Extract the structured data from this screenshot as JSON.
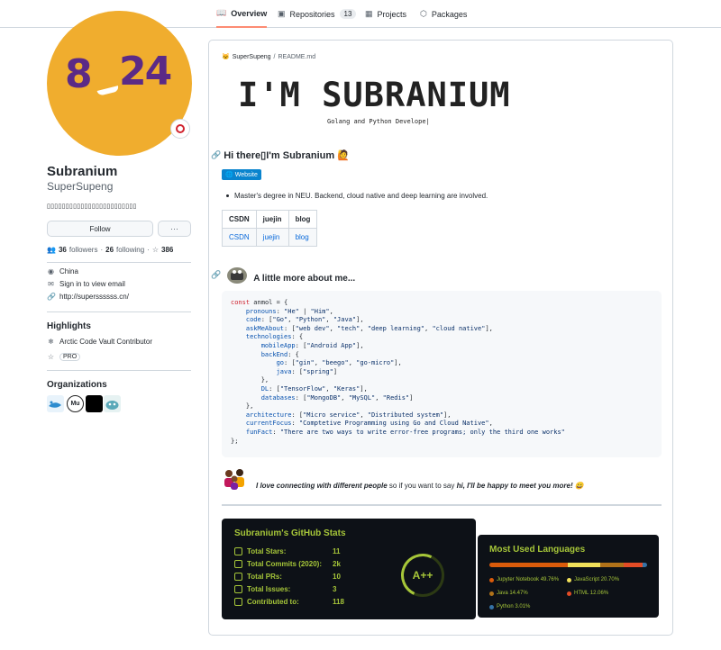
{
  "nav": {
    "tabs": [
      {
        "label": "Overview",
        "icon": "book-icon"
      },
      {
        "label": "Repositories",
        "icon": "repo-icon",
        "count": "13"
      },
      {
        "label": "Projects",
        "icon": "table-icon"
      },
      {
        "label": "Packages",
        "icon": "package-icon"
      }
    ]
  },
  "profile": {
    "avatar_text_left": "8",
    "avatar_text_right": "24",
    "name": "Subranium",
    "login": "SuperSupeng",
    "bio": "▯▯▯▯▯▯▯▯▯▯▯▯▯▯▯▯▯▯▯▯▯▯▯▯",
    "follow_label": "Follow",
    "more_label": "···",
    "followers_count": "36",
    "followers_label": "followers",
    "dot": "·",
    "following_count": "26",
    "following_label": "following",
    "stars_count": "386",
    "location": "China",
    "email": "Sign in to view email",
    "website": "http://superssssss.cn/"
  },
  "highlights": {
    "title": "Highlights",
    "items": [
      "Arctic Code Vault Contributor",
      "PRO"
    ]
  },
  "organizations": {
    "title": "Organizations",
    "org2_text": "Mu"
  },
  "readme": {
    "owner": "SuperSupeng",
    "slash": "/",
    "file": "README.md",
    "banner_title": "I'M SUBRANIUM",
    "banner_subtitle": "Golang and Python Develope|",
    "greeting": "Hi there▯I'm Subranium 🙋",
    "website_badge": "Website",
    "bullet": "Master's degree in NEU. Backend, cloud native and deep learning are involved.",
    "table": {
      "headers": [
        "CSDN",
        "juejin",
        "blog"
      ],
      "row": [
        "CSDN",
        "juejin",
        "blog"
      ]
    },
    "little_more": "A little more about me...",
    "connect_bold": "I love connecting with different people",
    "connect_middle": "so if you want to say",
    "connect_end": "hi, I'll be happy to meet you more! 😀"
  },
  "code_lines": [
    [
      [
        "k",
        "const "
      ],
      [
        "t",
        "anmol = {"
      ]
    ],
    [
      [
        "t",
        "    "
      ],
      [
        "p",
        "pronouns"
      ],
      [
        "t",
        ": "
      ],
      [
        "s",
        "\"He\""
      ],
      [
        "t",
        " | "
      ],
      [
        "s",
        "\"Him\""
      ],
      [
        "t",
        ","
      ]
    ],
    [
      [
        "t",
        "    "
      ],
      [
        "p",
        "code"
      ],
      [
        "t",
        ": ["
      ],
      [
        "s",
        "\"Go\""
      ],
      [
        "t",
        ", "
      ],
      [
        "s",
        "\"Python\""
      ],
      [
        "t",
        ", "
      ],
      [
        "s",
        "\"Java\""
      ],
      [
        "t",
        "],"
      ]
    ],
    [
      [
        "t",
        "    "
      ],
      [
        "p",
        "askMeAbout"
      ],
      [
        "t",
        ": ["
      ],
      [
        "s",
        "\"web dev\""
      ],
      [
        "t",
        ", "
      ],
      [
        "s",
        "\"tech\""
      ],
      [
        "t",
        ", "
      ],
      [
        "s",
        "\"deep learning\""
      ],
      [
        "t",
        ", "
      ],
      [
        "s",
        "\"cloud native\""
      ],
      [
        "t",
        "],"
      ]
    ],
    [
      [
        "t",
        "    "
      ],
      [
        "p",
        "technologies"
      ],
      [
        "t",
        ": {"
      ]
    ],
    [
      [
        "t",
        "        "
      ],
      [
        "p",
        "mobileApp"
      ],
      [
        "t",
        ": ["
      ],
      [
        "s",
        "\"Android App\""
      ],
      [
        "t",
        "],"
      ]
    ],
    [
      [
        "t",
        "        "
      ],
      [
        "p",
        "backEnd"
      ],
      [
        "t",
        ": {"
      ]
    ],
    [
      [
        "t",
        "            "
      ],
      [
        "p",
        "go"
      ],
      [
        "t",
        ": ["
      ],
      [
        "s",
        "\"gin\""
      ],
      [
        "t",
        ", "
      ],
      [
        "s",
        "\"beego\""
      ],
      [
        "t",
        ", "
      ],
      [
        "s",
        "\"go-micro\""
      ],
      [
        "t",
        "],"
      ]
    ],
    [
      [
        "t",
        "            "
      ],
      [
        "p",
        "java"
      ],
      [
        "t",
        ": ["
      ],
      [
        "s",
        "\"spring\""
      ],
      [
        "t",
        "]"
      ]
    ],
    [
      [
        "t",
        "        },"
      ]
    ],
    [
      [
        "t",
        "        "
      ],
      [
        "p",
        "DL"
      ],
      [
        "t",
        ": ["
      ],
      [
        "s",
        "\"TensorFlow\""
      ],
      [
        "t",
        ", "
      ],
      [
        "s",
        "\"Keras\""
      ],
      [
        "t",
        "],"
      ]
    ],
    [
      [
        "t",
        "        "
      ],
      [
        "p",
        "databases"
      ],
      [
        "t",
        ": ["
      ],
      [
        "s",
        "\"MongoDB\""
      ],
      [
        "t",
        ", "
      ],
      [
        "s",
        "\"MySQL\""
      ],
      [
        "t",
        ", "
      ],
      [
        "s",
        "\"Redis\""
      ],
      [
        "t",
        "]"
      ]
    ],
    [
      [
        "t",
        "    },"
      ]
    ],
    [
      [
        "t",
        "    "
      ],
      [
        "p",
        "architecture"
      ],
      [
        "t",
        ": ["
      ],
      [
        "s",
        "\"Micro service\""
      ],
      [
        "t",
        ", "
      ],
      [
        "s",
        "\"Distributed system\""
      ],
      [
        "t",
        "],"
      ]
    ],
    [
      [
        "t",
        "    "
      ],
      [
        "p",
        "currentFocus"
      ],
      [
        "t",
        ": "
      ],
      [
        "s",
        "\"Comptetive Programming using Go and Cloud Native\""
      ],
      [
        "t",
        ","
      ]
    ],
    [
      [
        "t",
        "    "
      ],
      [
        "p",
        "funFact"
      ],
      [
        "t",
        ": "
      ],
      [
        "s",
        "\"There are two ways to write error-free programs; only the third one works\""
      ]
    ],
    [
      [
        "t",
        "};"
      ]
    ]
  ],
  "stats": {
    "title": "Subranium's GitHub Stats",
    "rows": [
      {
        "label": "Total Stars:",
        "value": "11"
      },
      {
        "label": "Total Commits (2020):",
        "value": "2k"
      },
      {
        "label": "Total PRs:",
        "value": "10"
      },
      {
        "label": "Total Issues:",
        "value": "3"
      },
      {
        "label": "Contributed to:",
        "value": "118"
      }
    ],
    "grade": "A++"
  },
  "languages": {
    "title": "Most Used Languages",
    "items": [
      {
        "name": "Jupyter Notebook 49.76%",
        "color": "#DA5B0B",
        "pct": 49.76
      },
      {
        "name": "JavaScript 20.70%",
        "color": "#f1e05a",
        "pct": 20.7
      },
      {
        "name": "Java 14.47%",
        "color": "#b07219",
        "pct": 14.47
      },
      {
        "name": "HTML 12.06%",
        "color": "#e34c26",
        "pct": 12.06
      },
      {
        "name": "Python 3.01%",
        "color": "#3572A5",
        "pct": 3.01
      }
    ]
  },
  "colors": {
    "accent": "#fd8c73",
    "link": "#0969da",
    "stats_text": "#a6c639",
    "stats_bg": "#0d1117"
  }
}
